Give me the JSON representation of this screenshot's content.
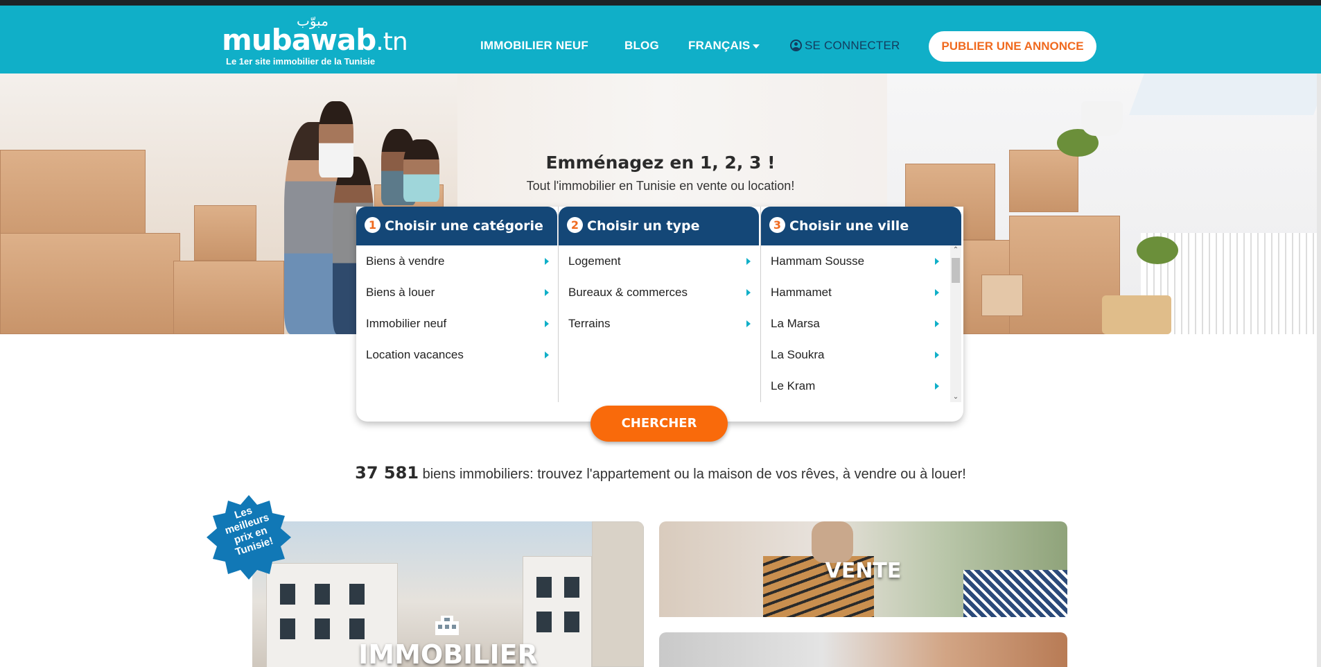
{
  "header": {
    "logo_arabic": "مبوّب",
    "logo_word": "mubawab",
    "logo_tld": ".tn",
    "logo_tagline": "Le 1er site immobilier de la Tunisie",
    "nav": [
      {
        "label": "IMMOBILIER NEUF"
      },
      {
        "label": "BLOG"
      },
      {
        "label": "FRANÇAIS"
      },
      {
        "label": "SE CONNECTER"
      }
    ],
    "publish_label": "PUBLIER UNE ANNONCE",
    "colors": {
      "bar": "#10afc8",
      "accent": "#f06a1f",
      "dark": "#144777"
    }
  },
  "hero": {
    "title": "Emménagez en 1, 2, 3 !",
    "subtitle": "Tout l'immobilier en Tunisie en vente ou location!"
  },
  "search": {
    "columns": [
      {
        "number": "1",
        "title": "Choisir une catégorie",
        "items": [
          "Biens à vendre",
          "Biens à louer",
          "Immobilier neuf",
          "Location vacances"
        ]
      },
      {
        "number": "2",
        "title": "Choisir un type",
        "items": [
          "Logement",
          "Bureaux & commerces",
          "Terrains"
        ]
      },
      {
        "number": "3",
        "title": "Choisir une ville",
        "items": [
          "Hammam Sousse",
          "Hammamet",
          "La Marsa",
          "La Soukra",
          "Le Kram"
        ]
      }
    ],
    "button_label": "CHERCHER"
  },
  "summary": {
    "count": "37 581",
    "text": "biens immobiliers: trouvez l'appartement ou la maison de vos rêves, à vendre ou à louer!"
  },
  "badge": {
    "line1": "Les",
    "line2": "meilleurs",
    "line3": "prix en",
    "line4": "Tunisie!"
  },
  "cards": {
    "immobilier_title": "IMMOBILIER",
    "vente_title": "VENTE"
  }
}
